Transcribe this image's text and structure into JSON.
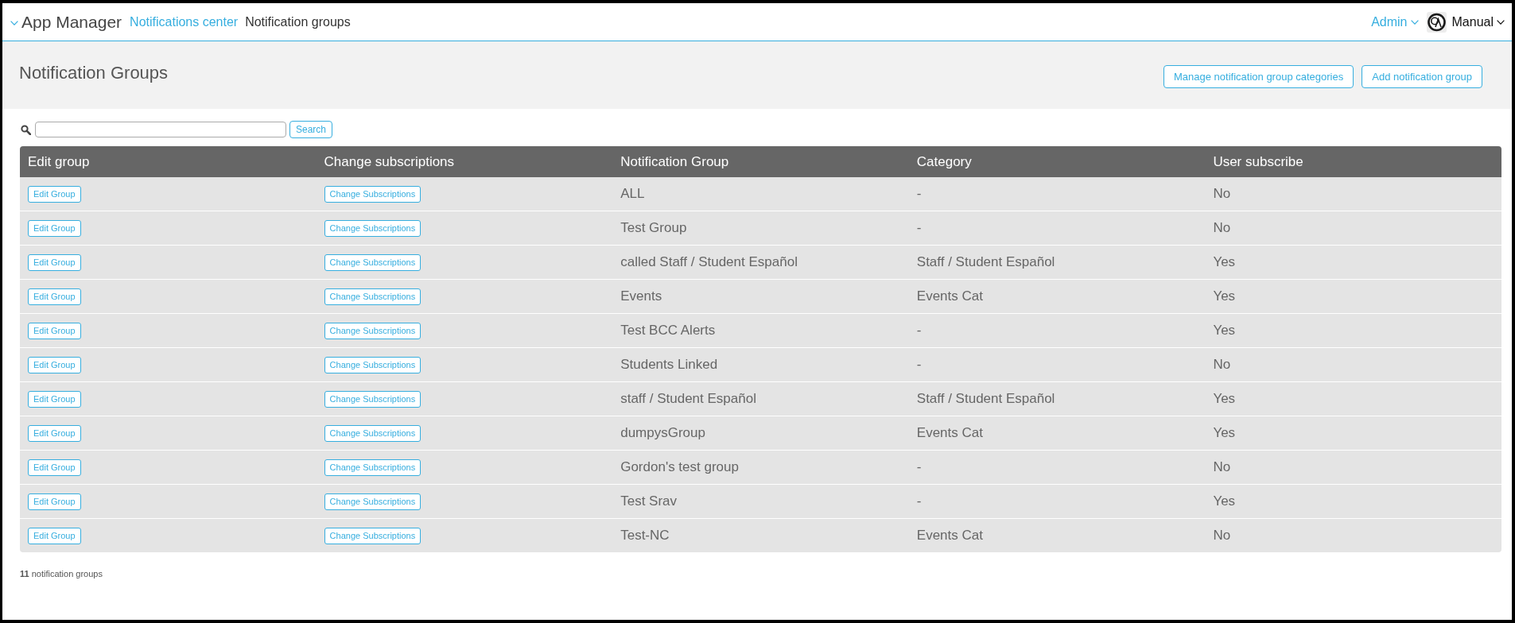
{
  "header": {
    "app_title": "App Manager",
    "breadcrumbs": [
      {
        "label": "Notifications center",
        "kind": "link"
      },
      {
        "label": "Notification groups",
        "kind": "current"
      }
    ],
    "admin_menu": "Admin",
    "user_menu": "Manual"
  },
  "page": {
    "title": "Notification Groups",
    "actions": [
      "Manage notification group categories",
      "Add notification group"
    ]
  },
  "search": {
    "button": "Search"
  },
  "table": {
    "columns": [
      {
        "label": "Edit group",
        "kind": "button"
      },
      {
        "label": "Change subscriptions",
        "kind": "button"
      },
      {
        "label": "Notification Group",
        "kind": "text"
      },
      {
        "label": "Category",
        "kind": "text"
      },
      {
        "label": "User subscribe",
        "kind": "text"
      }
    ],
    "rows": [
      {
        "cells": [
          "Edit Group",
          "Change Subscriptions",
          "ALL",
          "-",
          "No"
        ]
      },
      {
        "cells": [
          "Edit Group",
          "Change Subscriptions",
          "Test Group",
          "-",
          "No"
        ]
      },
      {
        "cells": [
          "Edit Group",
          "Change Subscriptions",
          "called Staff / Student Español",
          "Staff / Student Español",
          "Yes"
        ]
      },
      {
        "cells": [
          "Edit Group",
          "Change Subscriptions",
          "Events",
          "Events Cat",
          "Yes"
        ]
      },
      {
        "cells": [
          "Edit Group",
          "Change Subscriptions",
          "Test BCC Alerts",
          "-",
          "Yes"
        ]
      },
      {
        "cells": [
          "Edit Group",
          "Change Subscriptions",
          "Students Linked",
          "-",
          "No"
        ]
      },
      {
        "cells": [
          "Edit Group",
          "Change Subscriptions",
          "staff / Student Español",
          "Staff / Student Español",
          "Yes"
        ]
      },
      {
        "cells": [
          "Edit Group",
          "Change Subscriptions",
          "dumpysGroup",
          "Events Cat",
          "Yes"
        ]
      },
      {
        "cells": [
          "Edit Group",
          "Change Subscriptions",
          "Gordon's test group",
          "-",
          "No"
        ]
      },
      {
        "cells": [
          "Edit Group",
          "Change Subscriptions",
          "Test Srav",
          "-",
          "Yes"
        ]
      },
      {
        "cells": [
          "Edit Group",
          "Change Subscriptions",
          "Test-NC",
          "Events Cat",
          "No"
        ]
      }
    ]
  },
  "footer": {
    "count": "**11** notification groups"
  }
}
